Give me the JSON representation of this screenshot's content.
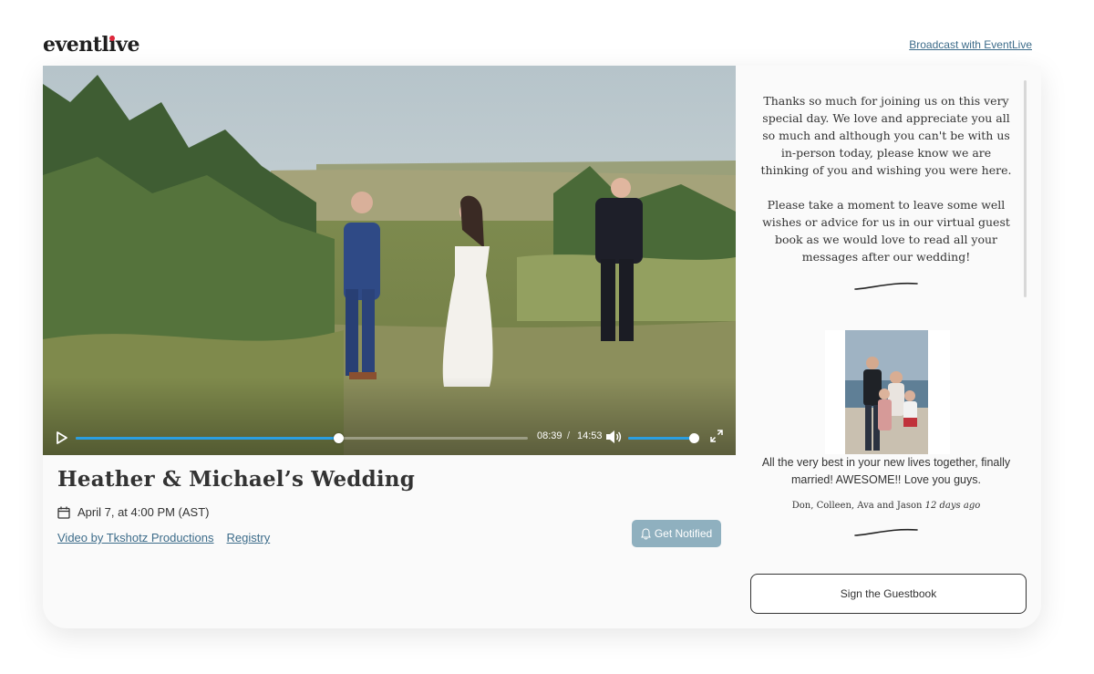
{
  "brand": {
    "logo_text_before": "eventl",
    "logo_text_i": "i",
    "logo_text_after": "ve",
    "accent_color": "#e0283c"
  },
  "header": {
    "broadcast_link": "Broadcast with EventLive"
  },
  "video": {
    "current_time": "08:39",
    "separator": "/",
    "duration": "14:53",
    "progress_fraction": 0.581,
    "volume_fraction": 0.96,
    "accent_color": "#2a9ee0"
  },
  "event": {
    "title": "Heather & Michael’s Wedding",
    "date": "April 7, at 4:00 PM (AST)",
    "links": [
      "Video by Tkshotz Productions",
      "Registry"
    ],
    "notify_label": "Get Notified"
  },
  "guestbook": {
    "welcome_paragraphs": [
      "Thanks so much for joining us on this very special day. We love and appreciate you all so much and although you can't be with us in-person today, please know we are thinking of you and wishing you were here.",
      "Please take a moment to leave some well wishes or advice for us in our virtual guest book as we would love to read all your messages after our wedding!"
    ],
    "entries": [
      {
        "message": "All the very best in your new lives together, finally married! AWESOME!! Love you guys.",
        "author": "Don, Colleen, Ava and Jason",
        "time_ago": "12 days ago"
      }
    ],
    "sign_button": "Sign the Guestbook"
  }
}
